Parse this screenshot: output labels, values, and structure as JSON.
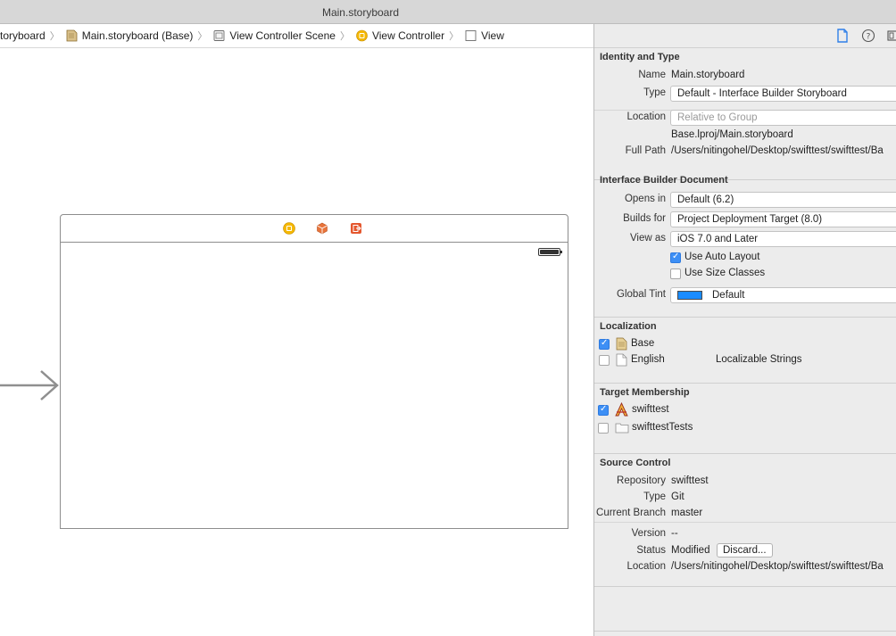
{
  "window": {
    "title": "Main.storyboard"
  },
  "jumpbar": {
    "items": [
      {
        "label": "toryboard",
        "icon": ""
      },
      {
        "label": "Main.storyboard (Base)",
        "icon": "storyboard-icon"
      },
      {
        "label": "View Controller Scene",
        "icon": "scene-icon"
      },
      {
        "label": "View Controller",
        "icon": "view-controller-icon"
      },
      {
        "label": "View",
        "icon": "view-icon"
      }
    ]
  },
  "inspector": {
    "identity": {
      "heading": "Identity and Type",
      "name_label": "Name",
      "name_value": "Main.storyboard",
      "type_label": "Type",
      "type_value": "Default - Interface Builder Storyboard",
      "location_label": "Location",
      "location_value": "Relative to Group",
      "relative_path": "Base.lproj/Main.storyboard",
      "full_path_label": "Full Path",
      "full_path_value": "/Users/nitingohel/Desktop/swifttest/swifttest/Ba"
    },
    "ib_document": {
      "heading": "Interface Builder Document",
      "opens_in_label": "Opens in",
      "opens_in_value": "Default (6.2)",
      "builds_for_label": "Builds for",
      "builds_for_value": "Project Deployment Target (8.0)",
      "view_as_label": "View as",
      "view_as_value": "iOS 7.0 and Later",
      "auto_layout_label": "Use Auto Layout",
      "auto_layout_checked": true,
      "size_classes_label": "Use Size Classes",
      "size_classes_checked": false,
      "global_tint_label": "Global Tint",
      "global_tint_value": "Default",
      "global_tint_color": "#1a8cff"
    },
    "localization": {
      "heading": "Localization",
      "items": [
        {
          "label": "Base",
          "checked": true,
          "extra": ""
        },
        {
          "label": "English",
          "checked": false,
          "extra": "Localizable Strings"
        }
      ]
    },
    "target_membership": {
      "heading": "Target Membership",
      "items": [
        {
          "label": "swifttest",
          "checked": true
        },
        {
          "label": "swifttestTests",
          "checked": false
        }
      ]
    },
    "source_control": {
      "heading": "Source Control",
      "repository_label": "Repository",
      "repository_value": "swifttest",
      "type_label": "Type",
      "type_value": "Git",
      "branch_label": "Current Branch",
      "branch_value": "master",
      "version_label": "Version",
      "version_value": "--",
      "status_label": "Status",
      "status_value": "Modified",
      "discard_label": "Discard...",
      "location_label": "Location",
      "location_value": "/Users/nitingohel/Desktop/swifttest/swifttest/Ba"
    }
  },
  "colors": {
    "accent": "#3d8ff5",
    "vc_icon": "#f5b800",
    "first_responder": "#e8743b",
    "exit": "#e4572e"
  }
}
